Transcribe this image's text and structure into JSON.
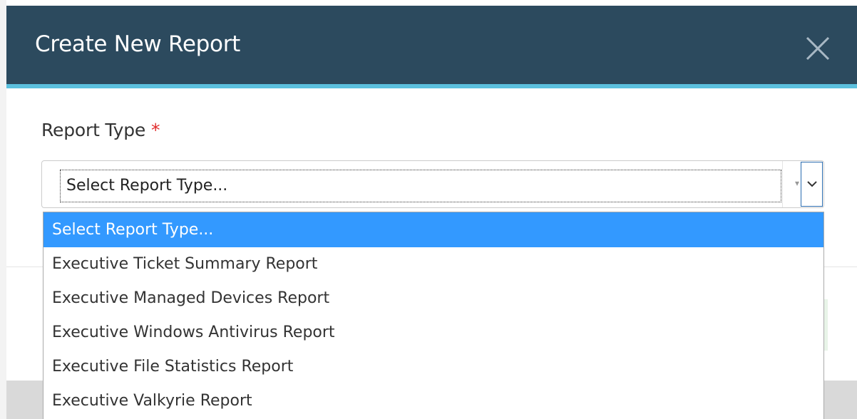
{
  "dialog": {
    "title": "Create New Report",
    "close_icon": "close-icon"
  },
  "form": {
    "report_type_label": "Report Type",
    "required_marker": "*",
    "select_value": "Select Report Type...",
    "dropdown_icon": "chevron-down-icon"
  },
  "dropdown": {
    "options": [
      {
        "label": "Select Report Type...",
        "selected": true
      },
      {
        "label": "Executive Ticket Summary Report",
        "selected": false
      },
      {
        "label": "Executive Managed Devices Report",
        "selected": false
      },
      {
        "label": "Executive Windows Antivirus Report",
        "selected": false
      },
      {
        "label": "Executive File Statistics Report",
        "selected": false
      },
      {
        "label": "Executive Valkyrie Report",
        "selected": false
      }
    ]
  },
  "colors": {
    "header_bg": "#2c4a5e",
    "header_accent": "#5bc0de",
    "selected_option_bg": "#3399ff",
    "required_marker": "#e02b2b"
  }
}
